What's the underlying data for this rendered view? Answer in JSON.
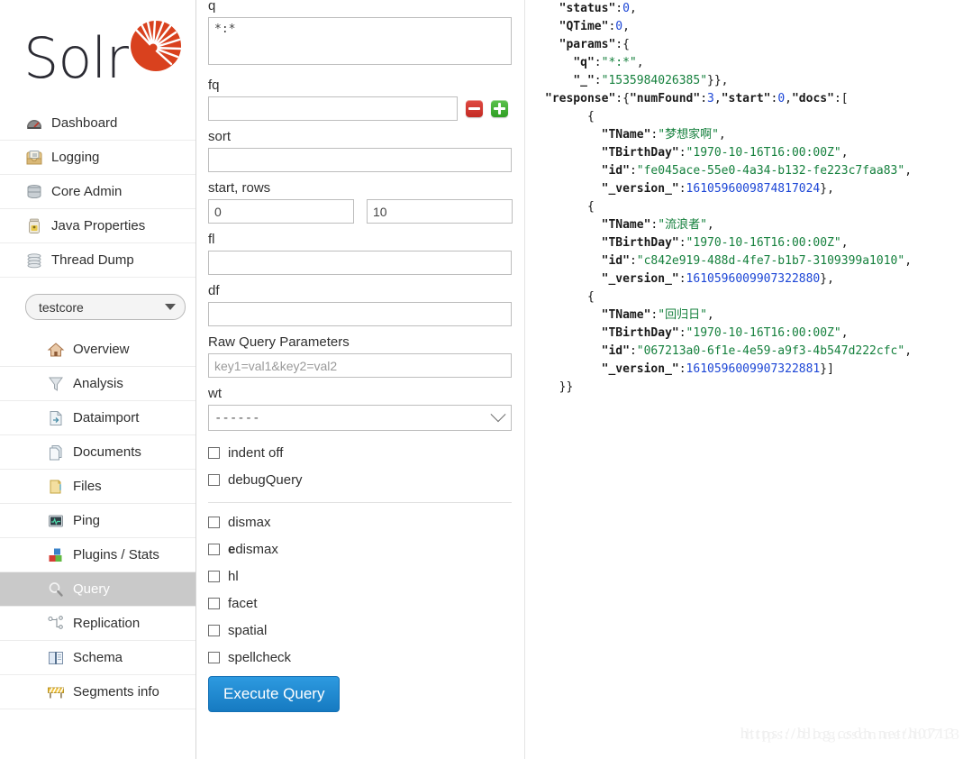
{
  "brand": {
    "name": "Solr",
    "logo_icon": "solr-sunburst-icon",
    "accent_color": "#d9411e",
    "text_color": "#2b2b33"
  },
  "sidebar": {
    "top_items": [
      {
        "label": "Dashboard",
        "icon": "dashboard-gauge-icon"
      },
      {
        "label": "Logging",
        "icon": "logging-tray-icon"
      },
      {
        "label": "Core Admin",
        "icon": "core-admin-database-icon"
      },
      {
        "label": "Java Properties",
        "icon": "java-properties-jar-icon"
      },
      {
        "label": "Thread Dump",
        "icon": "thread-dump-stack-icon"
      }
    ],
    "core_selector": {
      "value": "testcore",
      "icon": "chevron-down-icon"
    },
    "core_items": [
      {
        "label": "Overview",
        "icon": "overview-house-icon",
        "active": false
      },
      {
        "label": "Analysis",
        "icon": "analysis-funnel-icon",
        "active": false
      },
      {
        "label": "Dataimport",
        "icon": "dataimport-page-arrow-icon",
        "active": false
      },
      {
        "label": "Documents",
        "icon": "documents-pages-icon",
        "active": false
      },
      {
        "label": "Files",
        "icon": "files-folder-icon",
        "active": false
      },
      {
        "label": "Ping",
        "icon": "ping-monitor-icon",
        "active": false
      },
      {
        "label": "Plugins / Stats",
        "icon": "plugins-blocks-icon",
        "active": false
      },
      {
        "label": "Query",
        "icon": "query-magnifier-icon",
        "active": true
      },
      {
        "label": "Replication",
        "icon": "replication-nodes-icon",
        "active": false
      },
      {
        "label": "Schema",
        "icon": "schema-book-icon",
        "active": false
      },
      {
        "label": "Segments info",
        "icon": "segments-barrier-icon",
        "active": false
      }
    ]
  },
  "query_form": {
    "q": {
      "label": "q",
      "value": "*:*"
    },
    "fq": {
      "label": "fq",
      "value": "",
      "remove_icon": "minus-button-icon",
      "add_icon": "plus-button-icon"
    },
    "sort": {
      "label": "sort",
      "value": ""
    },
    "start_rows": {
      "label": "start, rows",
      "start_value": "0",
      "rows_value": "10"
    },
    "fl": {
      "label": "fl",
      "value": ""
    },
    "df": {
      "label": "df",
      "value": ""
    },
    "raw_query_parameters": {
      "label": "Raw Query Parameters",
      "value": "",
      "placeholder": "key1=val1&key2=val2"
    },
    "wt": {
      "label": "wt",
      "value": "------",
      "icon": "chevron-down-icon"
    },
    "options_group_1": [
      {
        "label": "indent off",
        "checked": false
      },
      {
        "label": "debugQuery",
        "checked": false
      }
    ],
    "options_group_2": [
      {
        "label": "dismax",
        "checked": false,
        "bold_prefix": ""
      },
      {
        "label": "dismax",
        "checked": false,
        "bold_prefix": "e"
      },
      {
        "label": "hl",
        "checked": false,
        "bold_prefix": ""
      },
      {
        "label": "facet",
        "checked": false,
        "bold_prefix": ""
      },
      {
        "label": "spatial",
        "checked": false,
        "bold_prefix": ""
      },
      {
        "label": "spellcheck",
        "checked": false,
        "bold_prefix": ""
      }
    ],
    "execute_button": "Execute Query"
  },
  "response": {
    "responseHeader": {
      "status": 0,
      "QTime": 0,
      "params": {
        "q": "*:*",
        "_": "1535984026385"
      }
    },
    "numFound": 3,
    "start": 0,
    "docs": [
      {
        "TName": "梦想家啊",
        "TBirthDay": "1970-10-16T16:00:00Z",
        "id": "fe045ace-55e0-4a34-b132-fe223c7faa83",
        "_version_": "1610596009874817024"
      },
      {
        "TName": "流浪者",
        "TBirthDay": "1970-10-16T16:00:00Z",
        "id": "c842e919-488d-4fe7-b1b7-3109399a1010",
        "_version_": "1610596009907322880"
      },
      {
        "TName": "回归日",
        "TBirthDay": "1970-10-16T16:00:00Z",
        "id": "067213a0-6f1e-4e59-a9f3-4b547d222cfc",
        "_version_": "1610596009907322881"
      }
    ]
  },
  "watermark": {
    "text": "https://blog.csdn.net/h0713"
  }
}
